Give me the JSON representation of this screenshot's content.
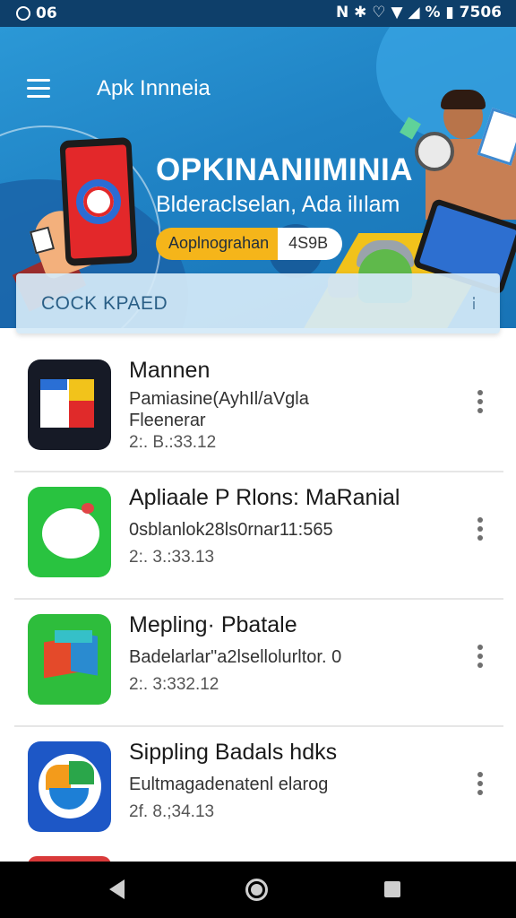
{
  "status_bar": {
    "left_text": "06",
    "right_text": "N ✱ ♡ ▼ ◢ % ▮ 7506"
  },
  "header": {
    "title": "Apk Innneia",
    "menu_icon": "hamburger-icon"
  },
  "banner": {
    "headline": "OPKINANIIMINIA",
    "subtitle": "Blderaclselan, Ada ilılam",
    "pill_left": "Aoplnograhan",
    "pill_right": "4S9B"
  },
  "search": {
    "placeholder": "COCK KPAED",
    "icon": "mic-icon"
  },
  "apps": [
    {
      "name": "Mannen",
      "desc_line1": "Pamiasine(AyhIl/aVgla",
      "desc_line2": "Fleenerar",
      "meta": "2:. B.:33.12",
      "icon": "red-white-flag-icon"
    },
    {
      "name": "Apliaale P Rlons: MaRanial",
      "desc_line1": "0sblanlok28ls0rnar11:565",
      "meta": "2:. 3.:33.13",
      "icon": "green-chat-bubble-icon"
    },
    {
      "name": "Mepling· Pbatale",
      "desc_line1": "Badelarlar\"a2lsellolurltor.   0",
      "meta": "2:. 3:332.12",
      "icon": "cube-icon"
    },
    {
      "name": "Sippling  Badals hdks",
      "desc_line1": "Eultmagadenatenl elarog",
      "meta": "2f. 8.;34.13",
      "icon": "circular-g-icon"
    }
  ],
  "colors": {
    "status_bar": "#0e3f6a",
    "banner": "#2b98d6",
    "accent_yellow": "#f5b51a",
    "nav_bar": "#000000"
  }
}
